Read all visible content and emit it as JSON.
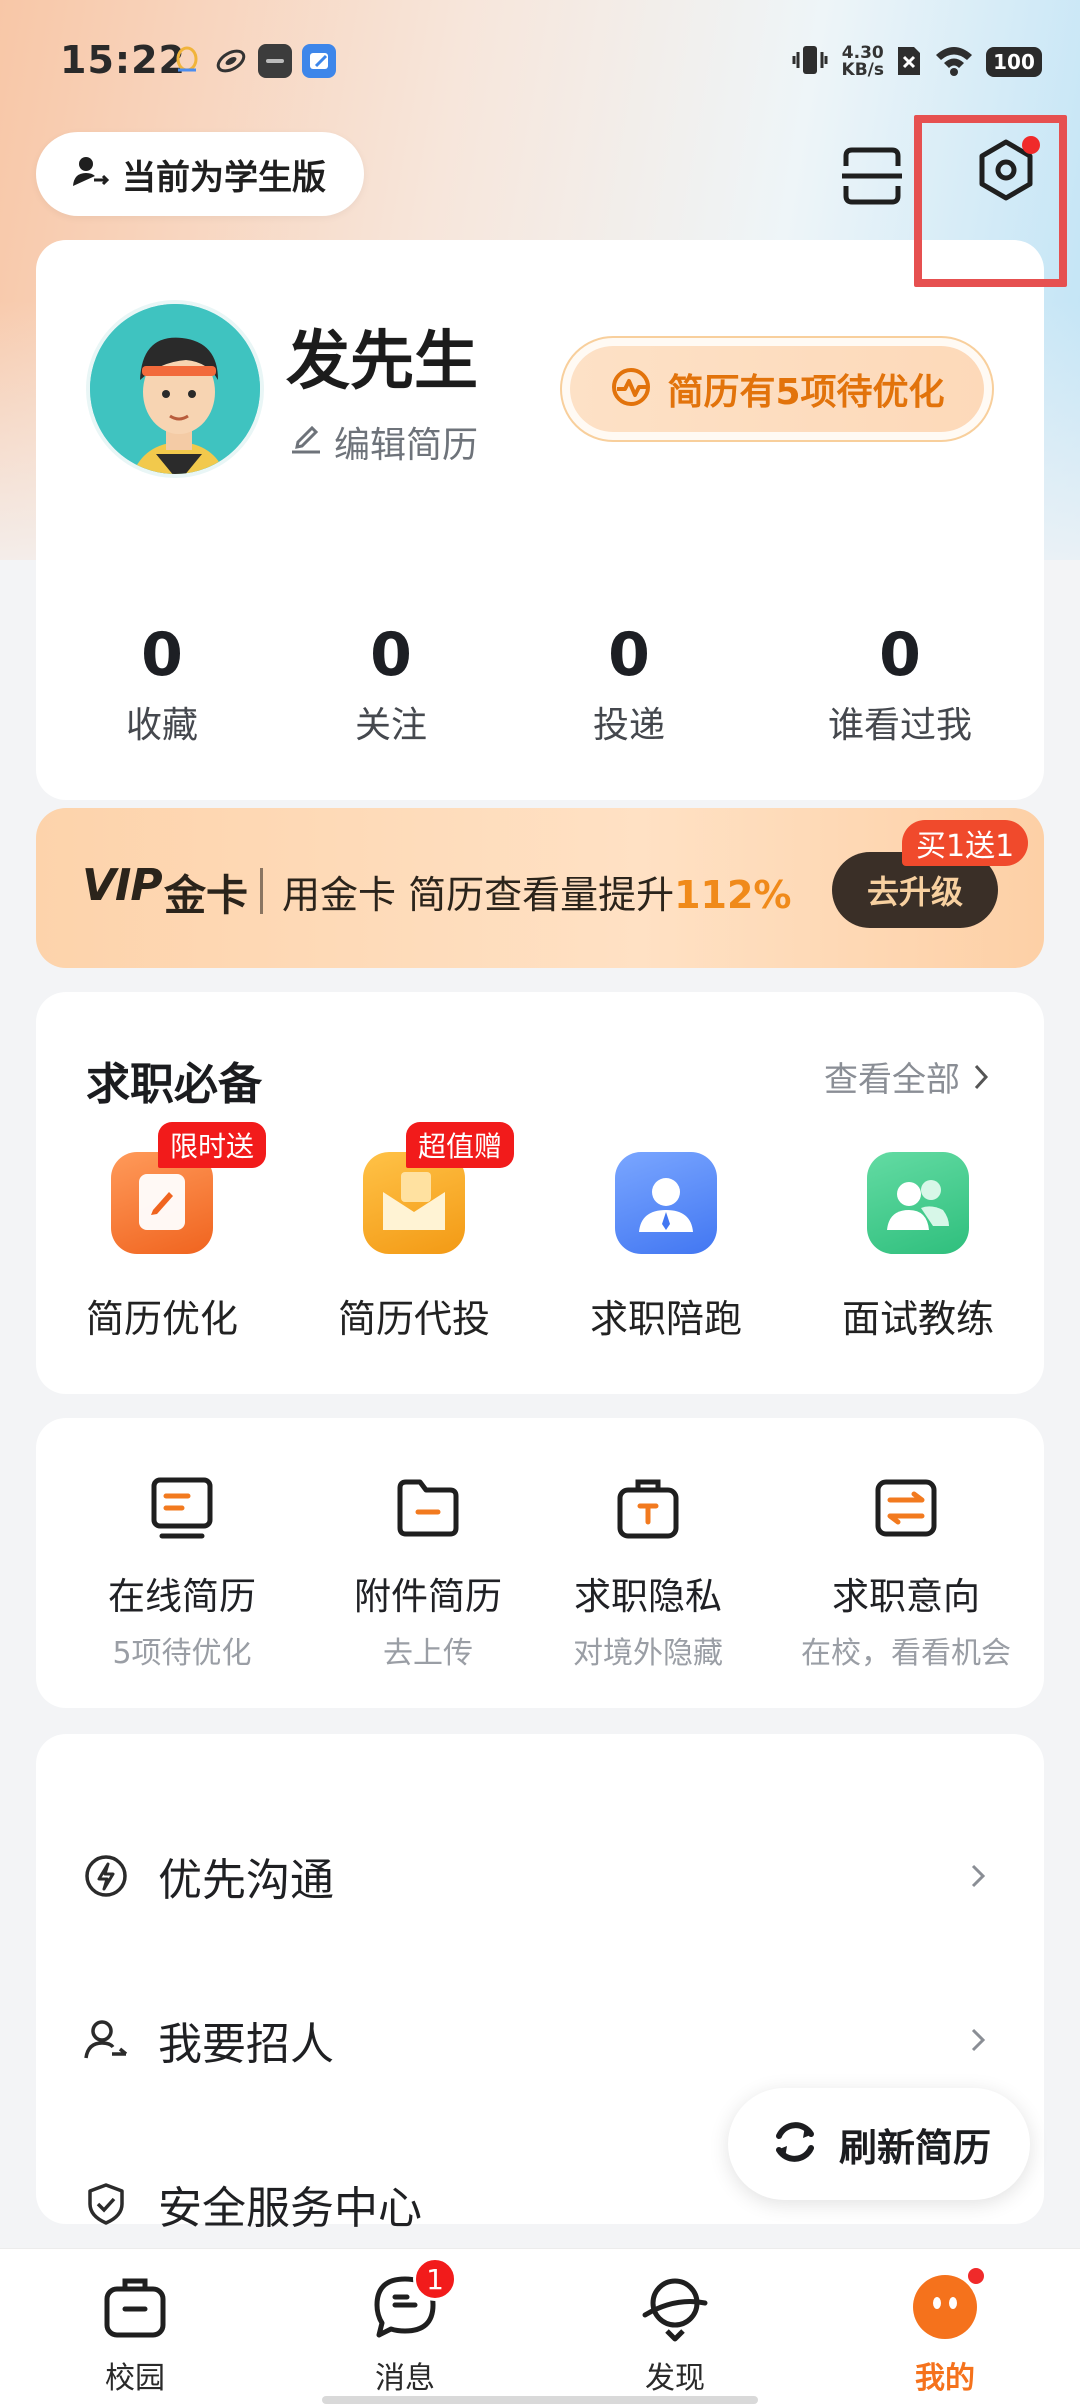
{
  "status_bar": {
    "time": "15:22",
    "net_speed_value": "4.30",
    "net_speed_unit": "KB/s",
    "battery": "100"
  },
  "header": {
    "student_mode_label": "当前为学生版",
    "scan_icon": "scan-icon",
    "settings_icon": "settings-icon"
  },
  "profile": {
    "name": "发先生",
    "edit_label": "编辑简历",
    "optimize_label": "简历有5项待优化",
    "stats": [
      {
        "value": "0",
        "label": "收藏"
      },
      {
        "value": "0",
        "label": "关注"
      },
      {
        "value": "0",
        "label": "投递"
      },
      {
        "value": "0",
        "label": "谁看过我"
      }
    ]
  },
  "vip": {
    "logo": "VIP",
    "gold_label": "金卡",
    "text": "用金卡 简历查看量提升",
    "percent": "112%",
    "button": "去升级",
    "tag": "买1送1"
  },
  "essentials": {
    "title": "求职必备",
    "view_all": "查看全部",
    "items": [
      {
        "label": "简历优化",
        "badge": "限时送",
        "icon": "resume-optimize-icon",
        "color": "#f5732c"
      },
      {
        "label": "简历代投",
        "badge": "超值赠",
        "icon": "envelope-icon",
        "color": "#f7a520"
      },
      {
        "label": "求职陪跑",
        "badge": "",
        "icon": "coach-person-icon",
        "color": "#4f86f7"
      },
      {
        "label": "面试教练",
        "badge": "",
        "icon": "interview-people-icon",
        "color": "#3bc98b"
      }
    ]
  },
  "tools": {
    "items": [
      {
        "label": "在线简历",
        "sub": "5项待优化",
        "icon": "online-resume-icon"
      },
      {
        "label": "附件简历",
        "sub": "去上传",
        "icon": "folder-icon"
      },
      {
        "label": "求职隐私",
        "sub": "对境外隐藏",
        "icon": "privacy-bag-icon"
      },
      {
        "label": "求职意向",
        "sub": "在校，看看机会",
        "icon": "intention-icon"
      }
    ]
  },
  "menu": {
    "items": [
      {
        "label": "优先沟通",
        "icon": "lightning-icon"
      },
      {
        "label": "我要招人",
        "icon": "recruit-person-icon"
      },
      {
        "label": "安全服务中心",
        "icon": "shield-check-icon"
      }
    ]
  },
  "refresh_button": "刷新简历",
  "bottom_nav": {
    "items": [
      {
        "label": "校园",
        "icon": "briefcase-icon"
      },
      {
        "label": "消息",
        "icon": "chat-bubble-icon",
        "badge": "1"
      },
      {
        "label": "发现",
        "icon": "planet-icon"
      },
      {
        "label": "我的",
        "icon": "mascot-face-icon"
      }
    ]
  },
  "colors": {
    "accent": "#f5721c",
    "optimize_text": "#e2730b",
    "badge_red": "#f21b1b"
  }
}
